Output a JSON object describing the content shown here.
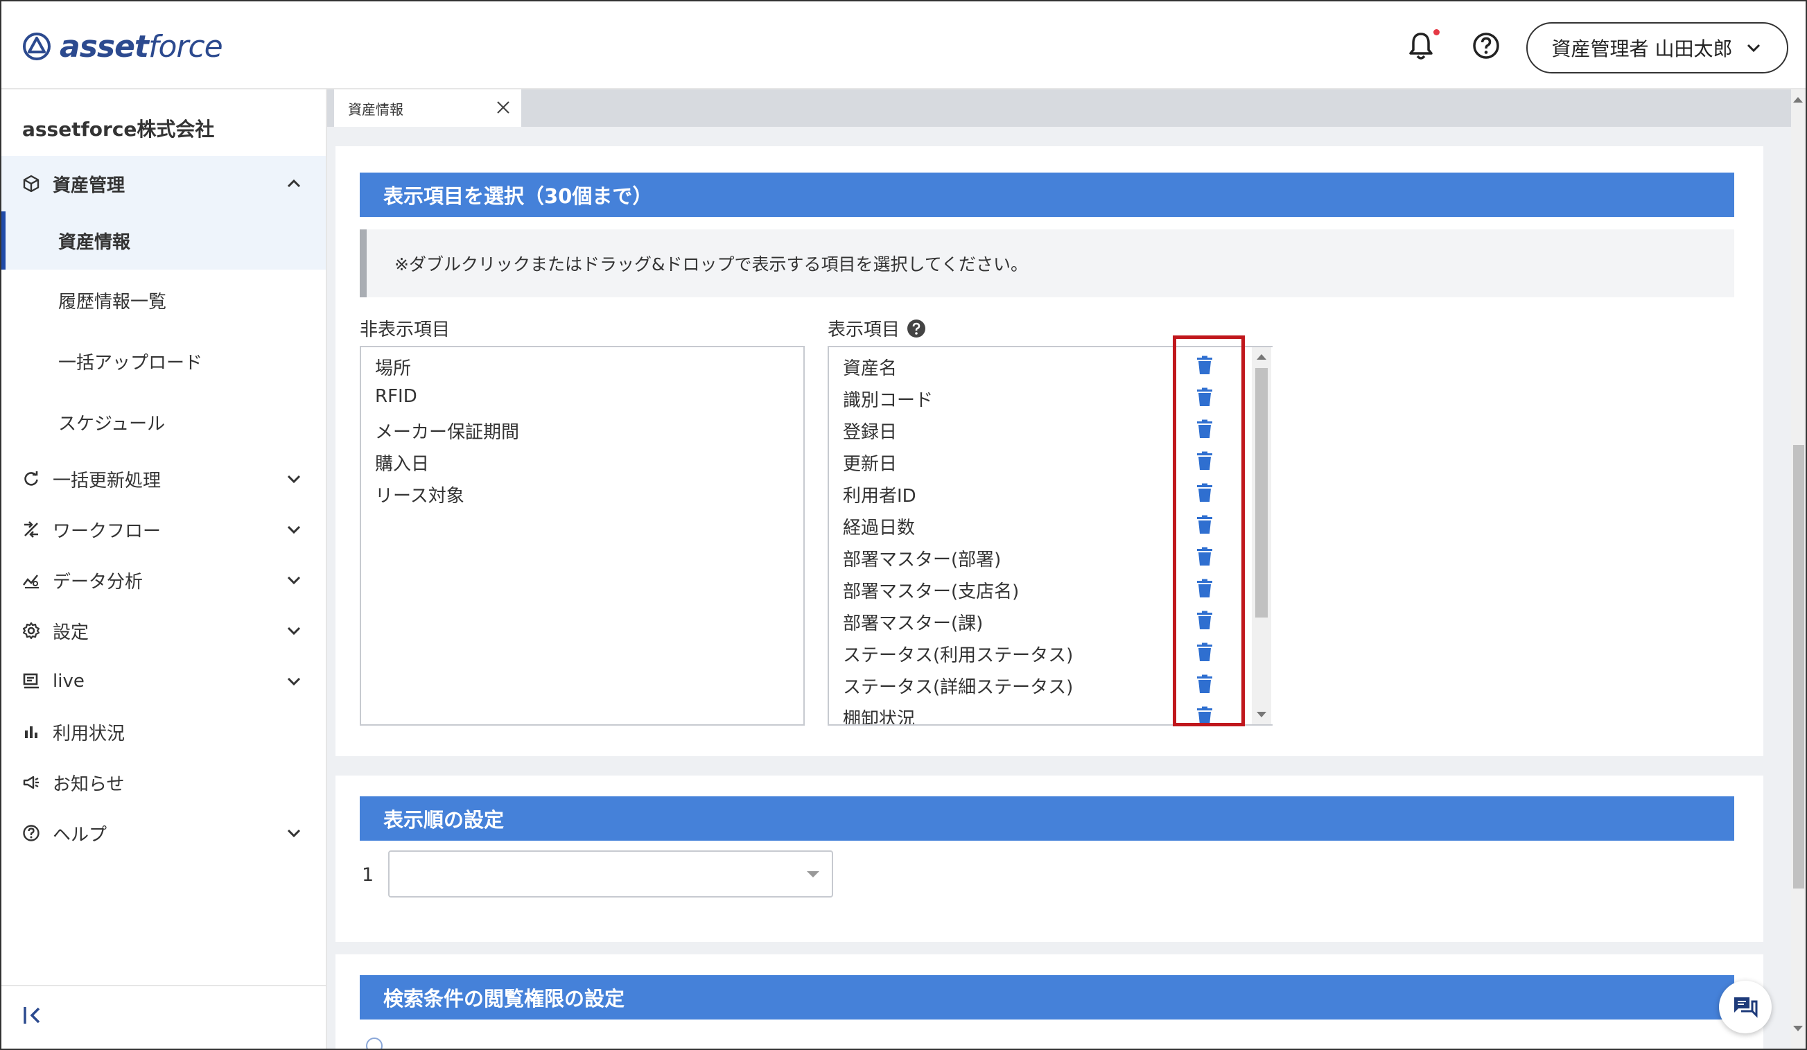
{
  "header": {
    "logo_bold": "asset",
    "logo_light": "force",
    "user_label": "資産管理者 山田太郎"
  },
  "sidebar": {
    "company": "assetforce株式会社",
    "sections": [
      {
        "label": "資産管理",
        "icon": "cube-icon",
        "expanded": true
      },
      {
        "label": "一括更新処理",
        "icon": "refresh-icon"
      },
      {
        "label": "ワークフロー",
        "icon": "workflow-icon"
      },
      {
        "label": "データ分析",
        "icon": "analytics-icon"
      },
      {
        "label": "設定",
        "icon": "gear-icon"
      },
      {
        "label": "live",
        "icon": "live-icon"
      },
      {
        "label": "利用状況",
        "icon": "bar-chart-icon"
      },
      {
        "label": "お知らせ",
        "icon": "megaphone-icon"
      },
      {
        "label": "ヘルプ",
        "icon": "help-circle-icon"
      }
    ],
    "subitems": [
      "資産情報",
      "履歴情報一覧",
      "一括アップロード",
      "スケジュール"
    ]
  },
  "tabs": [
    {
      "label": "資産情報"
    }
  ],
  "display_items_section": {
    "title": "表示項目を選択（30個まで）",
    "notice": "※ダブルクリックまたはドラッグ&ドロップで表示する項目を選択してください。",
    "hidden_label": "非表示項目",
    "shown_label": "表示項目",
    "hidden_items": [
      "場所",
      "RFID",
      "メーカー保証期間",
      "購入日",
      "リース対象"
    ],
    "shown_items": [
      "資産名",
      "識別コード",
      "登録日",
      "更新日",
      "利用者ID",
      "経過日数",
      "部署マスター(部署)",
      "部署マスター(支店名)",
      "部署マスター(課)",
      "ステータス(利用ステータス)",
      "ステータス(詳細ステータス)",
      "棚卸状況"
    ]
  },
  "sort_section": {
    "title": "表示順の設定",
    "row_number": "1",
    "select_value": ""
  },
  "permission_section": {
    "title": "検索条件の閲覧権限の設定"
  },
  "colors": {
    "accent": "#4581d9",
    "brand": "#2c4a8f",
    "highlight": "#c0171c",
    "trash": "#2f6fd0"
  }
}
